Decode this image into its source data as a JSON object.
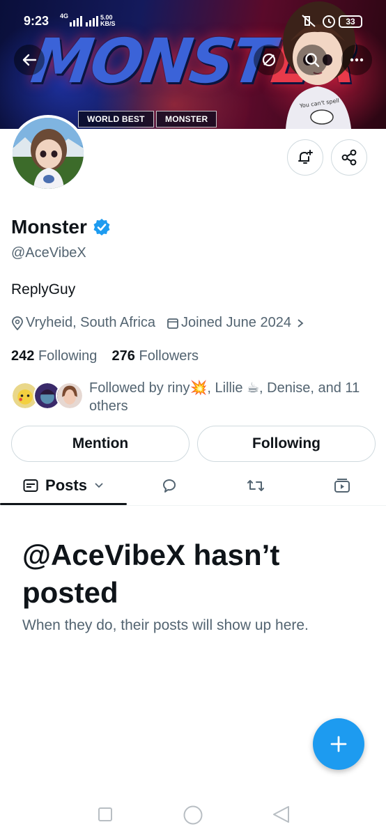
{
  "status_bar": {
    "time": "9:23",
    "network": "4G",
    "speed_value": "5.00",
    "speed_unit": "KB/S",
    "battery": "33"
  },
  "banner": {
    "title_part1": "MONST",
    "title_part2": "ER",
    "tag1": "WORLD BEST",
    "tag2": "MONSTER",
    "shirt_text": "You can't spell"
  },
  "header": {
    "back_icon": "arrow-left-icon",
    "hide_icon": "eye-off-icon",
    "search_icon": "search-icon",
    "more_icon": "more-horizontal-icon"
  },
  "profile": {
    "name": "Monster",
    "verified": true,
    "handle": "@AceVibeX",
    "bio": "ReplyGuy",
    "location": "Vryheid, South Africa",
    "joined": "Joined June 2024",
    "following_count": "242",
    "following_label": "Following",
    "followers_count": "276",
    "followers_label": "Followers",
    "followed_by": "Followed by riny💥, Lillie ☕, Denise, and 11 others"
  },
  "actions": {
    "mention": "Mention",
    "following": "Following"
  },
  "tabs": {
    "posts": "Posts"
  },
  "empty_state": {
    "title": "@AceVibeX hasn’t posted",
    "subtitle": "When they do, their posts will show up here."
  },
  "colors": {
    "accent": "#1d9bf0",
    "text": "#0f1419",
    "muted": "#536471"
  }
}
